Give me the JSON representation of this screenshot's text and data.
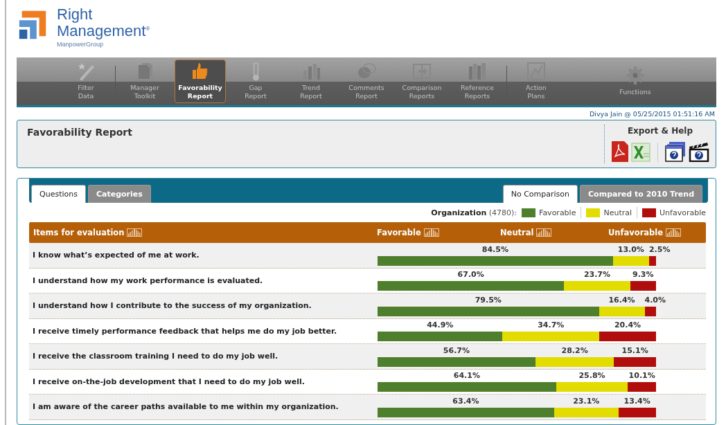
{
  "logo": {
    "name_line1": "Right",
    "name_line2": "Management",
    "mark": "®",
    "parent": "ManpowerGroup"
  },
  "nav": [
    {
      "label1": "Filter",
      "label2": "Data",
      "selected": false
    },
    {
      "label1": "Manager",
      "label2": "Toolkit",
      "selected": false
    },
    {
      "label1": "Favorability",
      "label2": "Report",
      "selected": true
    },
    {
      "label1": "Gap",
      "label2": "Report",
      "selected": false
    },
    {
      "label1": "Trend",
      "label2": "Report",
      "selected": false
    },
    {
      "label1": "Comments",
      "label2": "Report",
      "selected": false
    },
    {
      "label1": "Comparison",
      "label2": "Reports",
      "selected": false
    },
    {
      "label1": "Reference",
      "label2": "Reports",
      "selected": false
    },
    {
      "label1": "Action",
      "label2": "Plans",
      "selected": false
    },
    {
      "label1": "Functions",
      "selected": false
    }
  ],
  "user_stamp": "Divya Jain @ 05/25/2015 01:51:16 AM",
  "report_title": "Favorability Report",
  "export_help": {
    "title": "Export & Help"
  },
  "view_tabs": [
    {
      "label": "Questions",
      "selected": true
    },
    {
      "label": "Categories",
      "selected": false
    }
  ],
  "comparison_tabs": [
    {
      "label": "No Comparison",
      "selected": true
    },
    {
      "label": "Compared to 2010 Trend",
      "selected": false
    }
  ],
  "legend": {
    "group": "Organization",
    "count": "(4780):",
    "items": [
      {
        "label": "Favorable",
        "color": "#4e7f2c"
      },
      {
        "label": "Neutral",
        "color": "#e2dc00"
      },
      {
        "label": "Unfavorable",
        "color": "#b10d0d"
      }
    ]
  },
  "table": {
    "columns": [
      "Items for evaluation",
      "Favorable",
      "Neutral",
      "Unfavorable"
    ],
    "rows": [
      {
        "question": "I know what’s expected of me at work.",
        "segments": [
          {
            "value": "84.5%"
          },
          {
            "value": "13.0%"
          },
          {
            "value": "2.5%"
          }
        ]
      },
      {
        "question": "I understand how my work performance is evaluated.",
        "segments": [
          {
            "value": "67.0%"
          },
          {
            "value": "23.7%"
          },
          {
            "value": "9.3%"
          }
        ]
      },
      {
        "question": "I understand how I contribute to the success of my organization.",
        "segments": [
          {
            "value": "79.5%"
          },
          {
            "value": "16.4%"
          },
          {
            "value": "4.0%"
          }
        ]
      },
      {
        "question": "I receive timely performance feedback that helps me do my job better.",
        "segments": [
          {
            "value": "44.9%"
          },
          {
            "value": "34.7%"
          },
          {
            "value": "20.4%"
          }
        ]
      },
      {
        "question": "I receive the classroom training I need to do my job well.",
        "segments": [
          {
            "value": "56.7%"
          },
          {
            "value": "28.2%"
          },
          {
            "value": "15.1%"
          }
        ]
      },
      {
        "question": "I receive on-the-job development that I need to do my job well.",
        "segments": [
          {
            "value": "64.1%"
          },
          {
            "value": "25.8%"
          },
          {
            "value": "10.1%"
          }
        ]
      },
      {
        "question": "I am aware of the career paths available to me within my organization.",
        "segments": [
          {
            "value": "63.4%"
          },
          {
            "value": "23.1%"
          },
          {
            "value": "13.4%"
          }
        ]
      }
    ]
  }
}
